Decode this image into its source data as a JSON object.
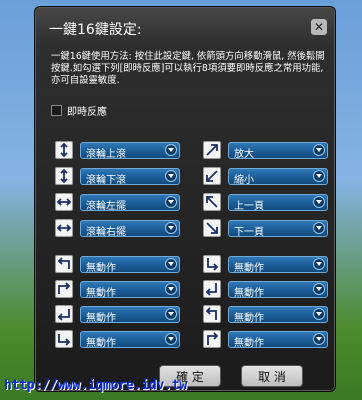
{
  "dialog": {
    "title": "一鍵16鍵設定:",
    "instructions": "一鍵16鍵使用方法: 按住此設定鍵, 依箭頭方向移動滑鼠, 然後鬆開按鍵.如勾選下列[即時反應]可以執行8項須要即時反應之常用功能, 亦可自設靈敏度.",
    "instant_label": "即時反應",
    "rows_left": [
      {
        "icon": "arrow-up-down-icon",
        "value": "滾輪上滾"
      },
      {
        "icon": "arrow-up-down-icon",
        "value": "滾輪下滾"
      },
      {
        "icon": "arrow-left-right-icon",
        "value": "滾輪左擺"
      },
      {
        "icon": "arrow-left-right-icon",
        "value": "滾輪右擺"
      },
      {
        "icon": "turn-left-up-icon",
        "value": "無動作"
      },
      {
        "icon": "turn-right-up-icon",
        "value": "無動作"
      },
      {
        "icon": "turn-left-down-icon",
        "value": "無動作"
      },
      {
        "icon": "turn-right-down-icon",
        "value": "無動作"
      }
    ],
    "rows_right": [
      {
        "icon": "arrow-up-right-icon",
        "value": "放大"
      },
      {
        "icon": "arrow-down-left-icon",
        "value": "縮小"
      },
      {
        "icon": "arrow-up-left-icon",
        "value": "上一頁"
      },
      {
        "icon": "arrow-down-right-icon",
        "value": "下一頁"
      },
      {
        "icon": "turn-up-right-icon",
        "value": "無動作"
      },
      {
        "icon": "turn-up-left-icon",
        "value": "無動作"
      },
      {
        "icon": "turn-down-left-icon",
        "value": "無動作"
      },
      {
        "icon": "turn-down-right-icon",
        "value": "無動作"
      }
    ],
    "ok_label": "確 定",
    "cancel_label": "取 消"
  },
  "watermark": "http://www.iqmore.idv.tw"
}
